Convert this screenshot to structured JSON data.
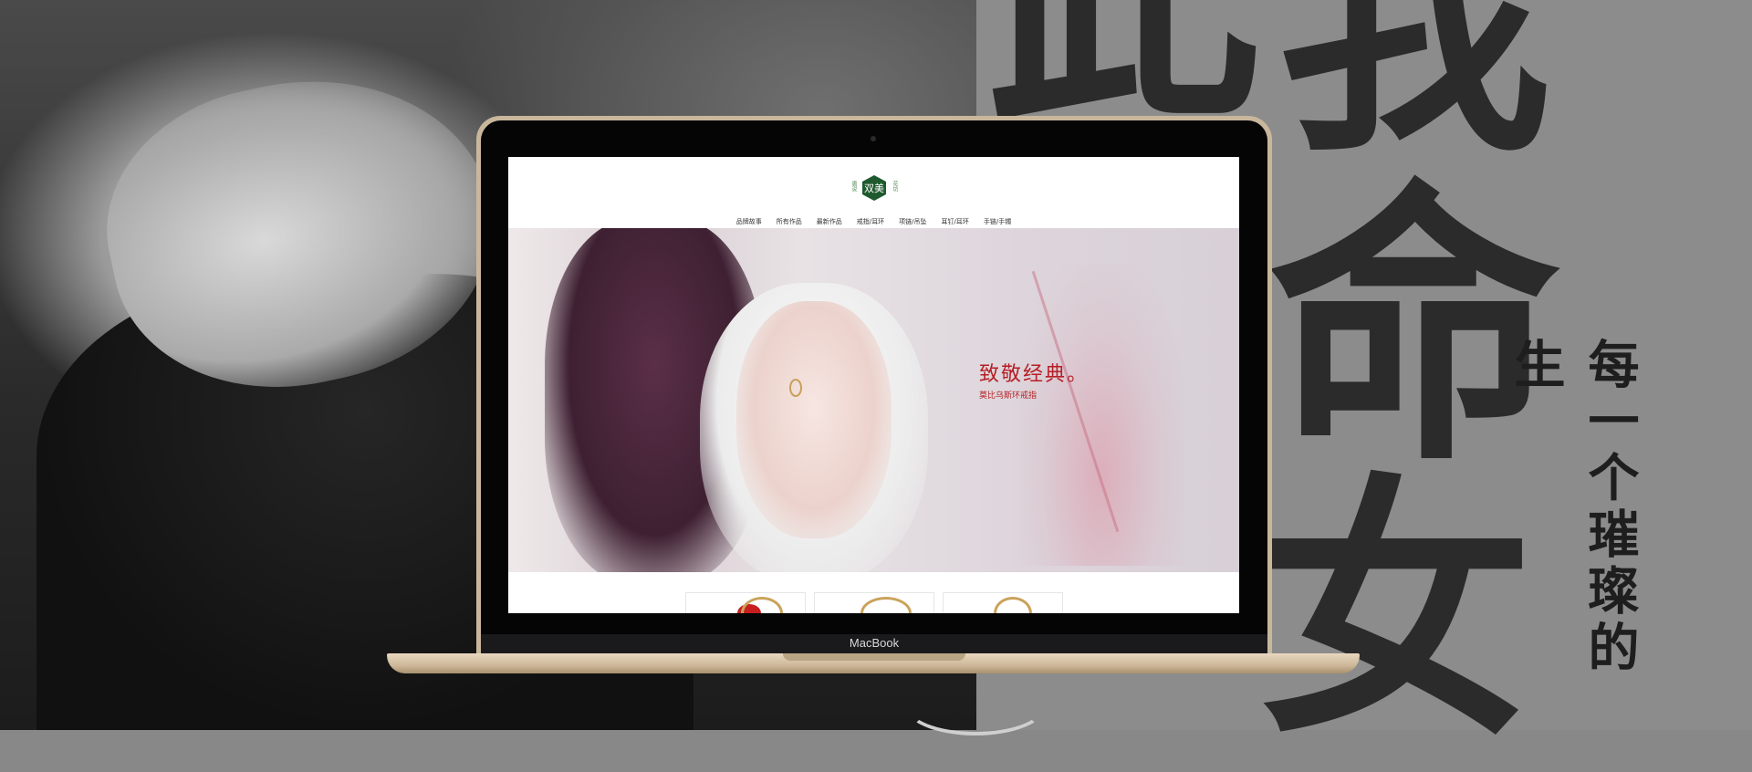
{
  "background": {
    "calligraphy": [
      "此",
      "我",
      "命",
      "女"
    ],
    "vertical_slogan": "每一个璀璨的生"
  },
  "laptop": {
    "brand": "MacBook"
  },
  "site": {
    "logo": {
      "mark": "双美",
      "left_text": "唐说",
      "right_text": "花坊"
    },
    "nav": [
      "品牌故事",
      "所有作品",
      "最新作品",
      "戒指/耳环",
      "项链/吊坠",
      "耳钉/耳环",
      "手链/手镯"
    ],
    "hero": {
      "title": "致敬经典。",
      "subtitle": "莫比乌斯环戒指"
    },
    "colors": {
      "accent": "#b51f25",
      "logo_green": "#1e5a2e",
      "gold": "#caa25a"
    }
  }
}
